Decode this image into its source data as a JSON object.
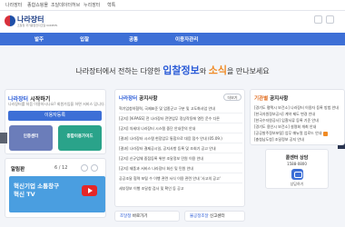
{
  "topbar": {
    "items": [
      "나라장터",
      "종합쇼핑몰",
      "조달데이터허브",
      "누리장터",
      "혁톡"
    ]
  },
  "header": {
    "logo_name": "나라장터",
    "logo_sub": "조달청 국가종합전자조달 KONEPS"
  },
  "nav": {
    "items": [
      "발주",
      "입찰",
      "공통",
      "이용자관리"
    ]
  },
  "hero": {
    "pre": "나라장터에서 전하는 다양한",
    "bid": "입찰정보",
    "mid": "와",
    "news": "소식",
    "post": "을 만나보세요"
  },
  "login": {
    "title_brand": "나라장터",
    "title_rest": " 시작하기",
    "desc": "나라장터를 처음 이용하시나요? 회원가입을 하면 서비스 입니다.",
    "login_button": "이용자등록",
    "tile_certificate": "인증센터",
    "tile_guide": "종합이용가이드"
  },
  "popup": {
    "label": "알림판",
    "page": "6 / 12",
    "banner_line1": "혁신기업 소통창구",
    "banner_line2": "혁신 TV"
  },
  "notice": {
    "title_brand": "나라장터",
    "title_rest": " 공지사항",
    "more": "더보기",
    "items": [
      "혁기업청하협력, 국제표준 및 업종군고 구분 및 고도화사업 안내",
      "[공지] [K-PASS] 전 나라장터 전면업무 정상작동에 열린 운수 다른",
      "[공지] 차세대 나라장터 시스템 중단 안내문의 안내",
      "[결과] 나라장터 시스템 현장업무 통합으로 대응 접수 안내 (05.09.)",
      "[결과] 나라장터 결제공시일, 공지사항 등록 및 조회기 공고 안내",
      "[공지] 신규업체 중점등록 위한 조달정보 민원 이용 안내",
      "[공지] 제품과 서비스 나라장터 회신 및 민원 안내",
      "공공조달 협력 포털 수 이행 관련 서식 이용 관련 안내 '사고의 공고'",
      "세부정보 이행 조달청 검사 및 확인 등 공고"
    ]
  },
  "institution": {
    "title_brand": "기관별",
    "title_rest": " 공지사항",
    "items": [
      "[경기도 평택시 보건소] 나라장터 이용자 등록 방법 안내",
      "[한국자원정보공사] 계약 제도 변경 안내",
      "[한국수자원공사] 입찰서류 등록 기준 안내",
      "[경기도 용인시 보건소] 설명회 개최 안내",
      "[공공발주정보포털] 업무 매뉴얼 업로드 안내",
      "[충청남도청] 조달정보 공지 안내"
    ]
  },
  "bottom": {
    "hrs_brand": "조달청",
    "hrs_rest": " 바로가기",
    "report_brand": "불공정조달",
    "report_rest": " 신고센터"
  },
  "consult": {
    "title": "콜센터 상담",
    "phone": "1588-0800",
    "label": "상담하기"
  },
  "colors": {
    "primary": "#3d6fd6",
    "accent_orange": "#f08a24",
    "tile_certificate": "#6b7dba",
    "tile_guide": "#2aa38a",
    "banner": "#4a9ee0"
  }
}
